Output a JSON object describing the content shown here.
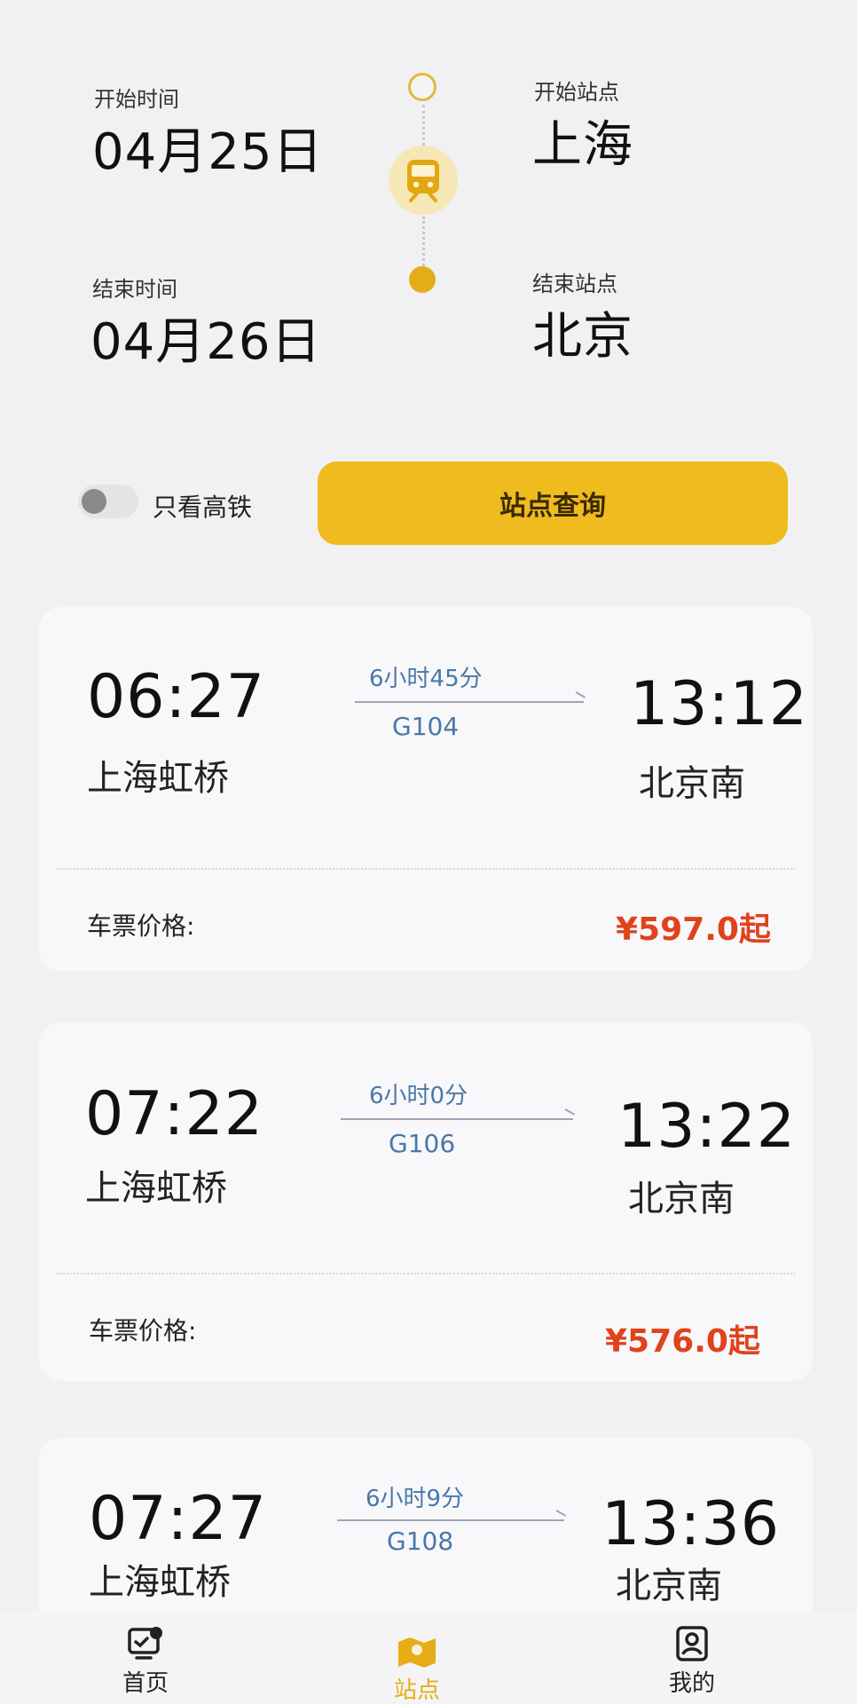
{
  "search": {
    "start_time_label": "开始时间",
    "start_date": "04月25日",
    "end_time_label": "结束时间",
    "end_date": "04月26日",
    "start_station_label": "开始站点",
    "start_station": "上海",
    "end_station_label": "结束站点",
    "end_station": "北京",
    "toggle_label": "只看高铁",
    "toggle_on": false,
    "query_button": "站点查询"
  },
  "results": [
    {
      "dep_time": "06:27",
      "dep_station": "上海虹桥",
      "duration": "6小时45分",
      "train_no": "G104",
      "arr_time": "13:12",
      "arr_station": "北京南",
      "price_label": "车票价格:",
      "price": "¥597.0起"
    },
    {
      "dep_time": "07:22",
      "dep_station": "上海虹桥",
      "duration": "6小时0分",
      "train_no": "G106",
      "arr_time": "13:22",
      "arr_station": "北京南",
      "price_label": "车票价格:",
      "price": "¥576.0起"
    },
    {
      "dep_time": "07:27",
      "dep_station": "上海虹桥",
      "duration": "6小时9分",
      "train_no": "G108",
      "arr_time": "13:36",
      "arr_station": "北京南"
    }
  ],
  "nav": {
    "items": [
      {
        "label": "首页",
        "icon": "home-icon"
      },
      {
        "label": "站点",
        "icon": "map-icon",
        "active": true
      },
      {
        "label": "我的",
        "icon": "profile-icon"
      }
    ]
  },
  "colors": {
    "accent": "#f0bb1e",
    "price": "#e0421c",
    "train_info": "#4a77a8"
  }
}
